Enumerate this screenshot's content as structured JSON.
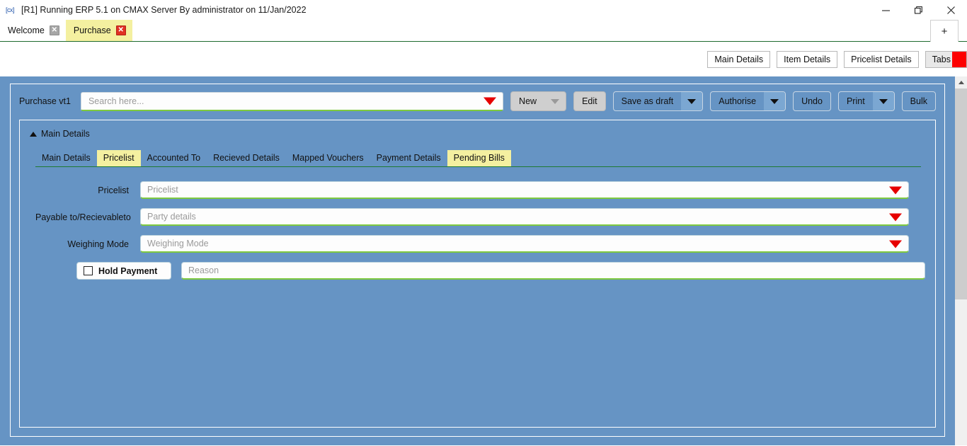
{
  "window": {
    "app_icon": "app-icon",
    "title": "[R1] Running ERP 5.1 on CMAX Server By administrator on 11/Jan/2022",
    "controls": {
      "minimize": "minimize-icon",
      "maximize": "restore-icon",
      "close": "close-icon"
    }
  },
  "tabstrip": {
    "tabs": [
      {
        "label": "Welcome",
        "active": false,
        "close": "✕"
      },
      {
        "label": "Purchase",
        "active": true,
        "close": "✕"
      }
    ],
    "add_tab_label": "+"
  },
  "toolband": {
    "buttons": [
      {
        "label": "Main Details"
      },
      {
        "label": "Item Details"
      },
      {
        "label": "Pricelist Details"
      },
      {
        "label": "Tabs"
      }
    ],
    "tabs_flag_color": "#fd0000"
  },
  "toolbar": {
    "form_label": "Purchase vt1",
    "search": {
      "value": "",
      "placeholder": "Search here..."
    },
    "new_label": "New",
    "edit_label": "Edit",
    "save_as_draft_label": "Save as draft",
    "authorise_label": "Authorise",
    "undo_label": "Undo",
    "print_label": "Print",
    "bulk_label": "Bulk"
  },
  "section": {
    "title": "Main Details",
    "collapse_icon": "triangle-up-icon"
  },
  "subtabs": [
    {
      "label": "Main Details",
      "highlighted": false
    },
    {
      "label": "Pricelist",
      "highlighted": true
    },
    {
      "label": "Accounted To",
      "highlighted": false
    },
    {
      "label": "Recieved Details",
      "highlighted": false
    },
    {
      "label": "Mapped Vouchers",
      "highlighted": false
    },
    {
      "label": "Payment Details",
      "highlighted": false
    },
    {
      "label": "Pending Bills",
      "highlighted": true
    }
  ],
  "form": {
    "rows": [
      {
        "label": "Pricelist",
        "value": "",
        "placeholder": "Pricelist",
        "has_dropdown": true
      },
      {
        "label": "Payable to/Recievableto",
        "value": "",
        "placeholder": "Party details",
        "has_dropdown": true
      },
      {
        "label": "Weighing Mode",
        "value": "",
        "placeholder": "Weighing Mode",
        "has_dropdown": true
      }
    ],
    "hold_payment": {
      "label": "Hold Payment",
      "checked": false,
      "reason": {
        "value": "",
        "placeholder": "Reason"
      }
    }
  },
  "scrollbar": {
    "up_arrow": "chevron-up-icon"
  },
  "colors": {
    "page_blue": "#6694c4",
    "highlight_yellow": "#f4f0a0",
    "accent_green": "#7ec93f",
    "tab_border_green": "#1f6b2e",
    "red_caret": "#e60000"
  }
}
